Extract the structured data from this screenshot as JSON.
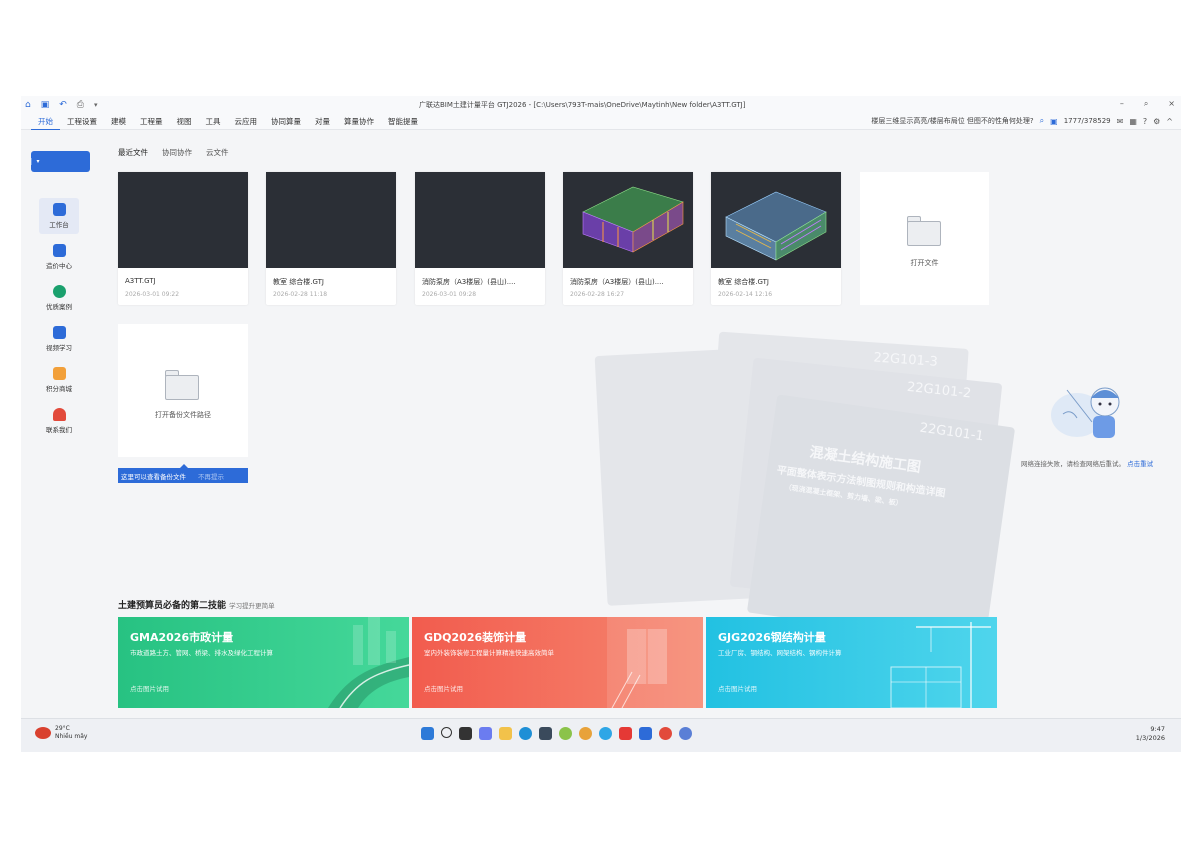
{
  "titlebar": {
    "title": "广联达BIM土建计量平台 GTJ2026 - [C:\\Users\\793T-mais\\OneDrive\\Maytinh\\New folder\\A3TT.GTJ]",
    "minimize": "–",
    "restore": "⌕",
    "close": "×"
  },
  "menu": {
    "items": [
      "开始",
      "工程设置",
      "建模",
      "工程量",
      "视图",
      "工具",
      "云应用",
      "协同算量",
      "对量",
      "算量协作",
      "智能提量"
    ],
    "right_text": "楼层三维显示高亮/楼层布局位  但图不的性角何处理?",
    "account": "1777/378529"
  },
  "sidebar": {
    "new_button": "+ 新建",
    "items": [
      {
        "label": "工作台",
        "color": "#2d6bd8"
      },
      {
        "label": "造价中心",
        "color": "#2d6bd8"
      },
      {
        "label": "优质案例",
        "color": "#1aa06d"
      },
      {
        "label": "视频学习",
        "color": "#2d6bd8"
      },
      {
        "label": "积分商城",
        "color": "#f2a03a"
      },
      {
        "label": "联系我们",
        "color": "#e24a3b"
      }
    ]
  },
  "tabs": [
    "最近文件",
    "协同协作",
    "云文件"
  ],
  "recent_files": [
    {
      "name": "A3TT.GTJ",
      "date": "2026-03-01 09:22",
      "thumb": "dark"
    },
    {
      "name": "教室 综合楼.GTJ",
      "date": "2026-02-28 11:18",
      "thumb": "dark"
    },
    {
      "name": "消防泵房（A3楼层）(县山)....",
      "date": "2026-03-01 09:28",
      "thumb": "dark"
    },
    {
      "name": "消防泵房（A3楼层）(县山)....",
      "date": "2026-02-28 16:27",
      "thumb": "model1"
    },
    {
      "name": "教室 综合楼.GTJ",
      "date": "2026-02-14 12:16",
      "thumb": "model2"
    }
  ],
  "open_card": {
    "label": "打开文件"
  },
  "backup_card": {
    "label": "打开备份文件路径"
  },
  "hint": {
    "text": "这里可以查看备份文件",
    "close": "不再提示"
  },
  "books": {
    "codes": [
      "22G101-3",
      "22G101-2",
      "22G101-1"
    ],
    "title_line1": "混凝土结构施工图",
    "title_line2": "平面整体表示方法制图规则和构造详图",
    "title_line3": "（现浇混凝土框架、剪力墙、梁、板）"
  },
  "right_panel": {
    "text": "网络连接失败，请检查网络后重试。",
    "link": "点击重试"
  },
  "promo": {
    "title": "土建预算员必备的第二技能",
    "subtitle": "学习提升更简单",
    "cards": [
      {
        "title": "GMA2026市政计量",
        "subtitle": "市政道路土方、管网、桥梁、排水及绿化工程计算",
        "button": "点击图片试用",
        "color": "#2dc78a"
      },
      {
        "title": "GDQ2026装饰计量",
        "subtitle": "室内外装饰装修工程量计算精准快速高效简单",
        "button": "点击图片试用",
        "color": "#f2695a"
      },
      {
        "title": "GJG2026钢结构计量",
        "subtitle": "工业厂房、钢结构、网架结构、钢构件计算",
        "button": "点击图片试用",
        "color": "#2bc6e6"
      }
    ]
  },
  "taskbar": {
    "weather_temp": "29°C",
    "weather_desc": "Nhiều mây",
    "time": "9:47",
    "date": "1/3/2026"
  }
}
